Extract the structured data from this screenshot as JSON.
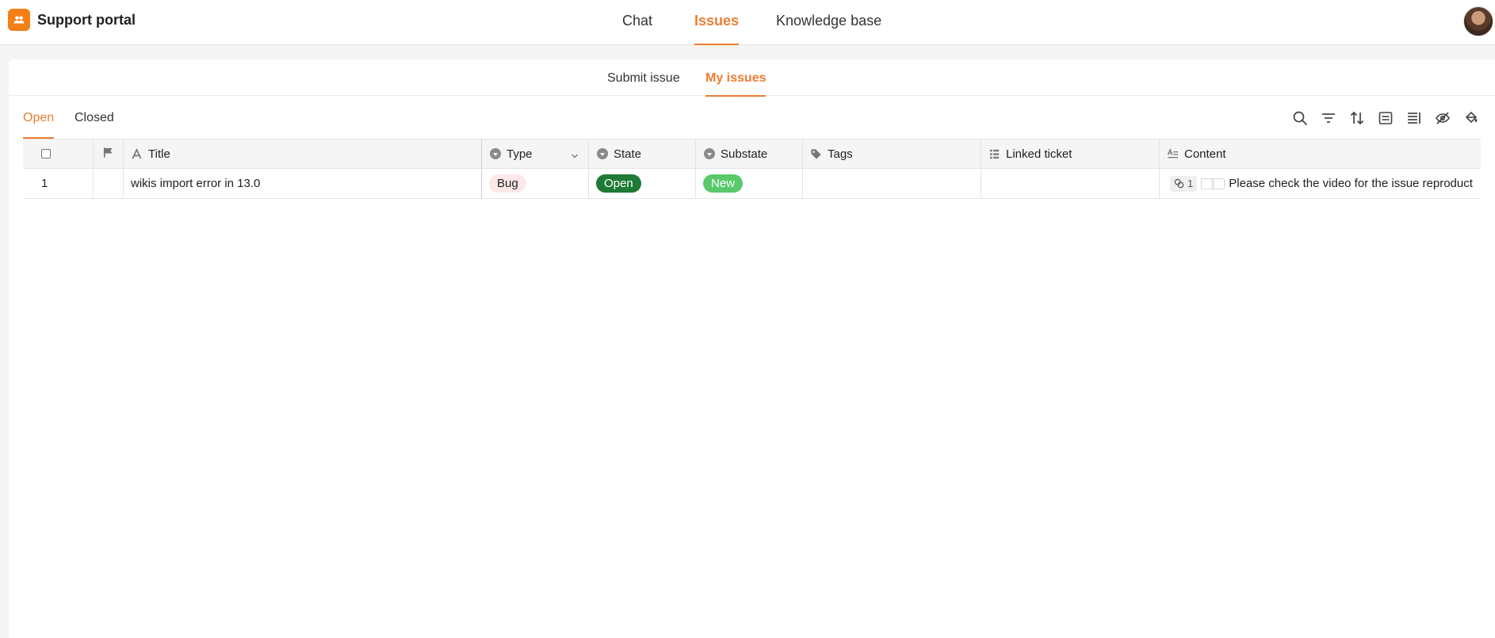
{
  "app": {
    "title": "Support portal",
    "brand_color": "#f57f17",
    "accent_color": "#ed7d31"
  },
  "main_nav": {
    "tabs": [
      {
        "label": "Chat",
        "active": false
      },
      {
        "label": "Issues",
        "active": true
      },
      {
        "label": "Knowledge base",
        "active": false
      }
    ]
  },
  "sub_nav": {
    "tabs": [
      {
        "label": "Submit issue",
        "active": false
      },
      {
        "label": "My issues",
        "active": true
      }
    ]
  },
  "filters": {
    "tabs": [
      {
        "label": "Open",
        "active": true
      },
      {
        "label": "Closed",
        "active": false
      }
    ]
  },
  "toolbar": {
    "icons": [
      "search-icon",
      "filter-icon",
      "sort-icon",
      "group-icon",
      "row-height-icon",
      "hide-columns-icon",
      "paint-bucket-icon"
    ]
  },
  "table": {
    "columns": {
      "title": "Title",
      "type": "Type",
      "state": "State",
      "substate": "Substate",
      "tags": "Tags",
      "linked_ticket": "Linked ticket",
      "content": "Content"
    },
    "rows": [
      {
        "num": "1",
        "title": "wikis import error in 13.0",
        "type": "Bug",
        "state": "Open",
        "substate": "New",
        "tags": "",
        "linked_ticket": "",
        "content_comments": "1",
        "content_text": "Please check the video for the issue reproduct"
      }
    ],
    "colors": {
      "bug_bg": "#fde8e8",
      "open_bg": "#1e7a34",
      "new_bg": "#59c96b"
    }
  }
}
